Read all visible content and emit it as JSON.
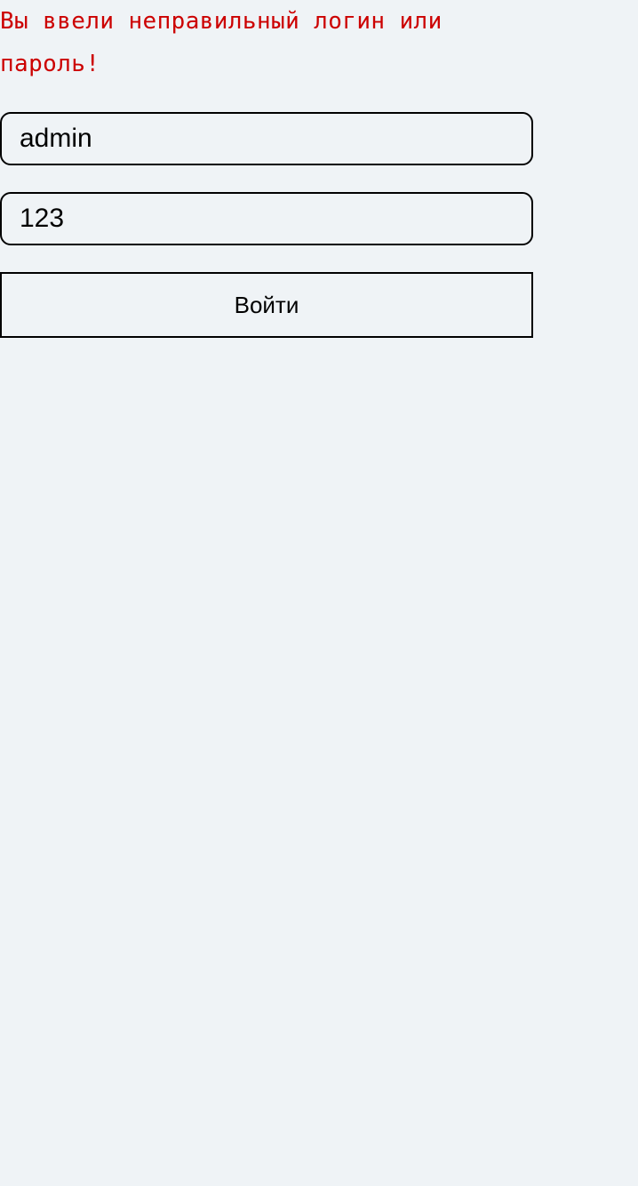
{
  "error": {
    "message": "Вы ввели неправильный логин или пароль!",
    "color": "#cc0000"
  },
  "form": {
    "login_value": "admin",
    "password_value": "123",
    "submit_label": "Войти"
  },
  "colors": {
    "background": "#eff3f6",
    "border": "#000000"
  }
}
